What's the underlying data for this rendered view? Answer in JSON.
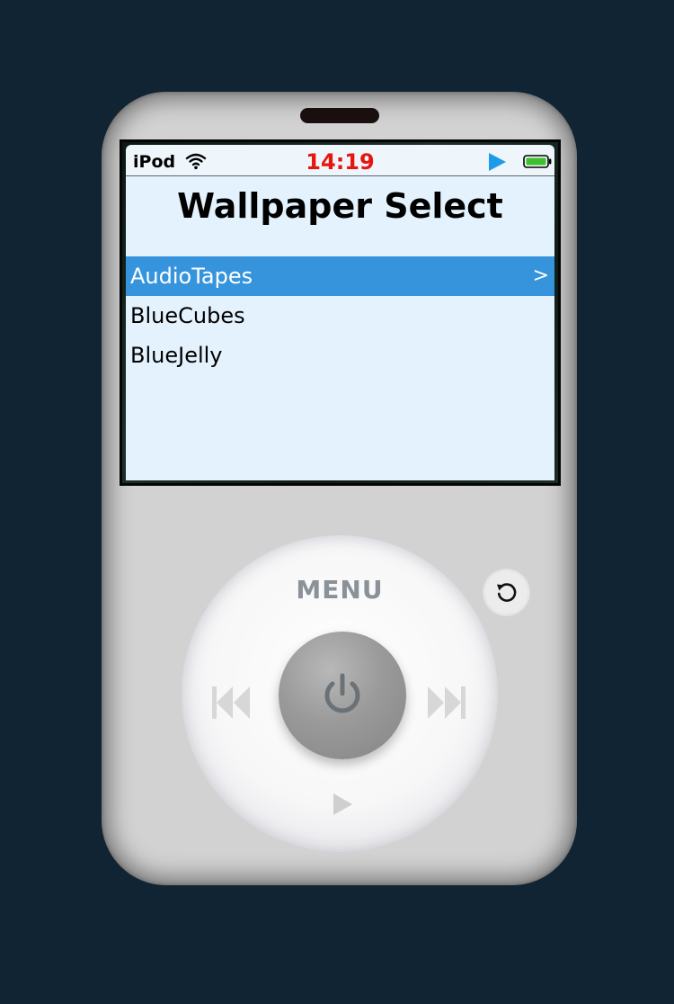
{
  "status_bar": {
    "device_name": "iPod",
    "time": "14:19",
    "wifi_icon": "wifi-icon",
    "play_state_icon": "play-icon",
    "battery_icon": "battery-icon"
  },
  "screen": {
    "title": "Wallpaper Select",
    "items": [
      {
        "label": "AudioTapes",
        "selected": true,
        "chevron": ">"
      },
      {
        "label": "BlueCubes",
        "selected": false
      },
      {
        "label": "BlueJelly",
        "selected": false
      }
    ]
  },
  "wheel": {
    "menu_label": "MENU",
    "prev_icon": "rewind-icon",
    "next_icon": "fast-forward-icon",
    "play_icon": "play-icon",
    "center_icon": "power-icon"
  },
  "reset_icon": "reset-icon",
  "colors": {
    "background": "#102433",
    "body": "#d2d2d2",
    "screen": "#e4f2fd",
    "selection": "#3694dc",
    "clock": "#e8140f",
    "play_state": "#1e9be8",
    "battery": "#3ec02e"
  }
}
